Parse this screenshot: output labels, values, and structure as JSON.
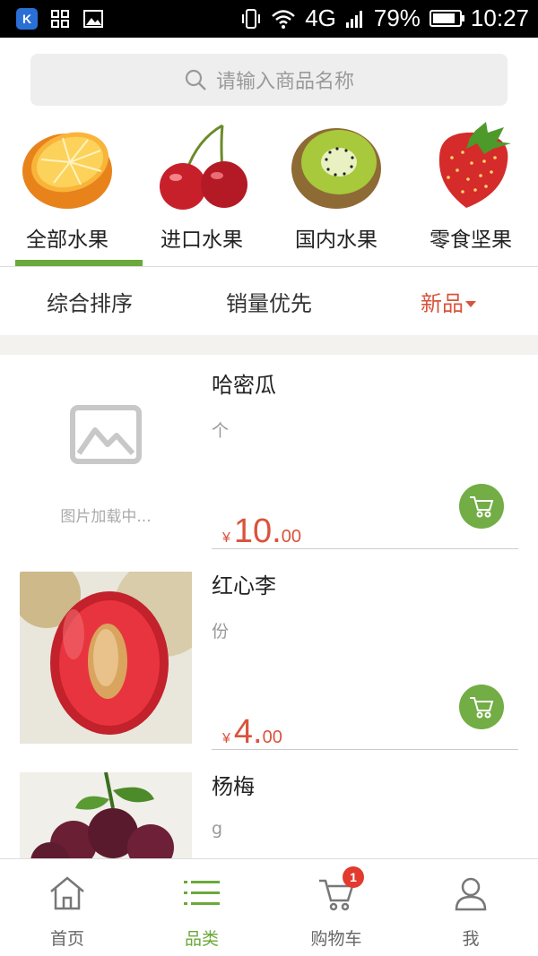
{
  "status_bar": {
    "network": "4G",
    "battery": "79%",
    "time": "10:27"
  },
  "search": {
    "placeholder": "请输入商品名称"
  },
  "categories": [
    {
      "label": "全部水果",
      "icon": "orange-icon",
      "active": true
    },
    {
      "label": "进口水果",
      "icon": "cherry-icon",
      "active": false
    },
    {
      "label": "国内水果",
      "icon": "kiwi-icon",
      "active": false
    },
    {
      "label": "零食坚果",
      "icon": "strawberry-icon",
      "active": false
    }
  ],
  "sort": [
    {
      "label": "综合排序",
      "active": false
    },
    {
      "label": "销量优先",
      "active": false
    },
    {
      "label": "新品",
      "active": true
    }
  ],
  "products": [
    {
      "name": "哈密瓜",
      "unit": "个",
      "currency": "¥",
      "price_int": "10.",
      "price_dec": "00",
      "image_state": "图片加载中..."
    },
    {
      "name": "红心李",
      "unit": "份",
      "currency": "¥",
      "price_int": "4.",
      "price_dec": "00",
      "image": "plum-photo"
    },
    {
      "name": "杨梅",
      "unit": "g",
      "image": "bayberry-photo"
    }
  ],
  "bottom_nav": [
    {
      "label": "首页",
      "icon": "home-icon",
      "active": false
    },
    {
      "label": "品类",
      "icon": "list-icon",
      "active": true
    },
    {
      "label": "购物车",
      "icon": "cart-icon",
      "active": false,
      "badge": "1"
    },
    {
      "label": "我",
      "icon": "user-icon",
      "active": false
    }
  ],
  "colors": {
    "accent_green": "#6aa93a",
    "price_red": "#d9533c",
    "cart_green": "#72ad45"
  }
}
